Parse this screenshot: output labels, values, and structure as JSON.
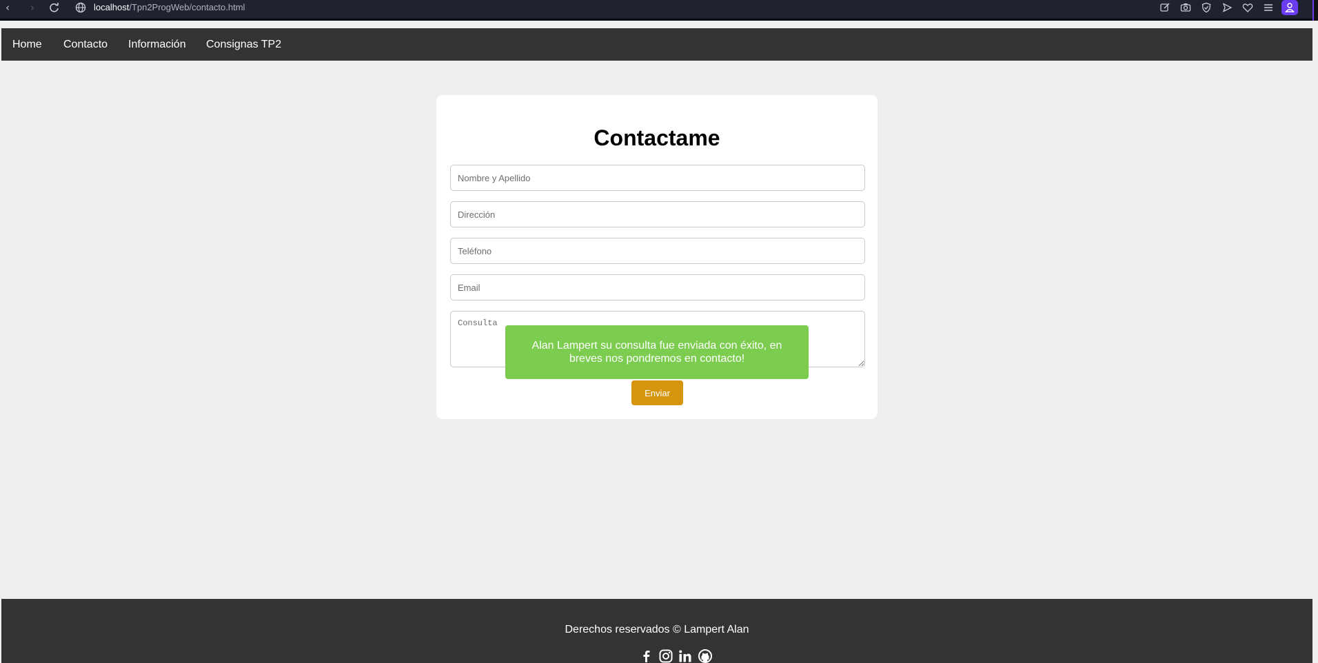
{
  "browser": {
    "url_host": "localhost",
    "url_path": "/Tpn2ProgWeb/contacto.html"
  },
  "nav": {
    "items": [
      {
        "label": "Home"
      },
      {
        "label": "Contacto"
      },
      {
        "label": "Información"
      },
      {
        "label": "Consignas TP2"
      }
    ]
  },
  "form": {
    "title": "Contactame",
    "fields": {
      "name": {
        "placeholder": "Nombre y Apellido"
      },
      "address": {
        "placeholder": "Dirección"
      },
      "phone": {
        "placeholder": "Teléfono"
      },
      "email": {
        "placeholder": "Email"
      },
      "query": {
        "placeholder": "Consulta"
      }
    },
    "submit_label": "Enviar"
  },
  "toast": {
    "message": "Alan Lampert su consulta fue enviada con éxito, en breves nos pondremos en contacto!"
  },
  "footer": {
    "text": "Derechos reservados © Lampert Alan",
    "social_icons": [
      "facebook-icon",
      "instagram-icon",
      "linkedin-icon",
      "github-icon"
    ]
  },
  "colors": {
    "navbar": "#333333",
    "page_bg": "#efefef",
    "submit": "#d6950e",
    "toast": "#7ccc4f",
    "browser_accent": "#6a3df0"
  }
}
